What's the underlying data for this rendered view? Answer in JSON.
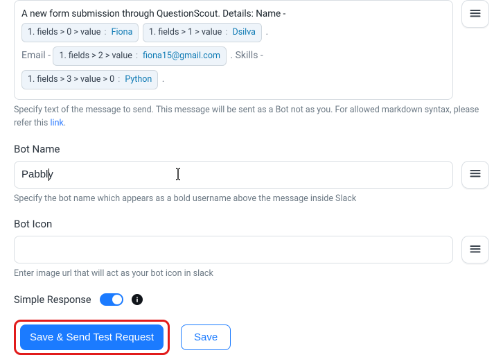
{
  "messageField": {
    "intro": "A new form submission through QuestionScout. Details: Name -",
    "tokens": [
      {
        "index": "1.",
        "path": "fields > 0 > value",
        "value": "Fiona",
        "after": ""
      },
      {
        "index": "1.",
        "path": "fields > 1 > value",
        "value": "Dsilva",
        "after": "."
      }
    ],
    "email_prefix": " Email -",
    "email_token": {
      "index": "1.",
      "path": "fields > 2 > value",
      "value": "fiona15@gmail.com",
      "after": "."
    },
    "skills_prefix": " Skills -",
    "skills_token": {
      "index": "1.",
      "path": "fields > 3 > value > 0",
      "value": "Python",
      "after": "."
    },
    "help_prefix": "Specify text of the message to send. This message will be sent as a Bot not as you. For allowed markdown syntax, please refer this ",
    "help_link": "link",
    "help_suffix": "."
  },
  "botName": {
    "label": "Bot Name",
    "value": "Pabbly",
    "help": "Specify the bot name which appears as a bold username above the message inside Slack"
  },
  "botIcon": {
    "label": "Bot Icon",
    "value": "",
    "help": "Enter image url that will act as your bot icon in slack"
  },
  "simpleResponse": {
    "label": "Simple Response",
    "enabled": true
  },
  "buttons": {
    "primary": "Save & Send Test Request",
    "secondary": "Save"
  }
}
